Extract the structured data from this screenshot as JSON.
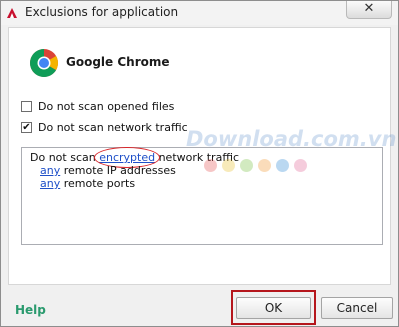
{
  "window": {
    "title": "Exclusions for application",
    "close_label": "✕"
  },
  "app": {
    "name": "Google Chrome"
  },
  "options": [
    {
      "label": "Do not scan opened files",
      "checked": false
    },
    {
      "label": "Do not scan network traffic",
      "checked": true
    }
  ],
  "rules": {
    "line1_prefix": "Do not scan ",
    "line1_link": "encrypted",
    "line1_suffix": " network traffic",
    "ip_link": "any",
    "ip_text": " remote IP addresses",
    "ports_link": "any",
    "ports_text": " remote ports"
  },
  "watermark": {
    "text": "Download.com.vn"
  },
  "footer": {
    "help": "Help",
    "ok": "OK",
    "cancel": "Cancel"
  },
  "colors": {
    "accent_red": "#b5161c",
    "link": "#1e4fc8",
    "help": "#2a9a6e"
  }
}
